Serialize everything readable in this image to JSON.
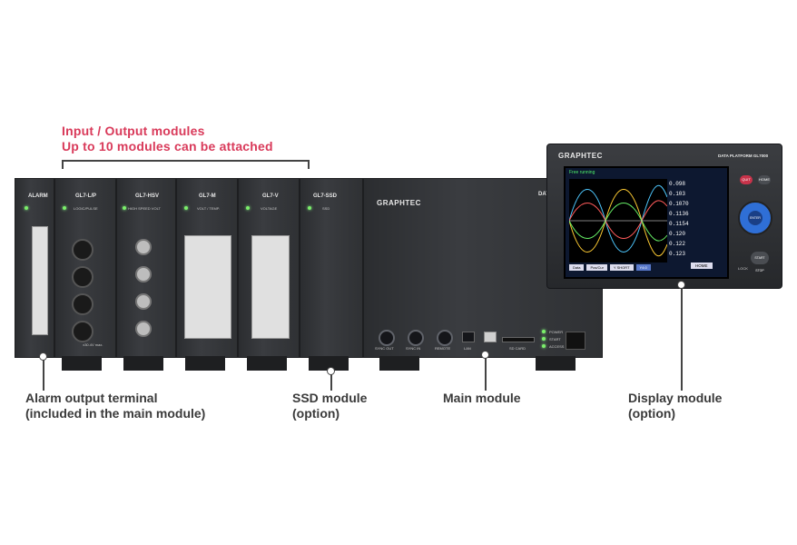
{
  "captions": {
    "io_line1": "Input / Output modules",
    "io_line2": "Up to 10 modules can be attached",
    "alarm_line1": "Alarm output terminal",
    "alarm_line2": "(included in the main module)",
    "ssd_line1": "SSD module",
    "ssd_line2": "(option)",
    "main_line1": "Main module",
    "display_line1": "Display module",
    "display_line2": "(option)"
  },
  "modules": {
    "alarm": "ALARM",
    "lp": "GL7-L/P",
    "lp_sub": "LOGIC/PULSE",
    "lp_note": "±30.4V max.",
    "hsv": "GL7-HSV",
    "hsv_sub": "HIGH SPEED VOLT",
    "m": "GL7-M",
    "m_sub": "VOLT / TEMP.",
    "v": "GL7-V",
    "v_sub": "VOLTAGE",
    "ssd": "GL7-SSD",
    "ssd_sub": "SSD",
    "brand": "GRAPHTEC",
    "main_edge": "DATA",
    "port_sync_out": "SYNC OUT",
    "port_sync_in": "SYNC IN",
    "port_remote": "REMOTE",
    "port_lan": "LAN",
    "port_sd": "SD CARD",
    "status_power": "POWER",
    "status_start": "START",
    "status_access": "ACCESS"
  },
  "display": {
    "brand": "GRAPHTEC",
    "model": "DATA PLATFORM GL7000",
    "mode": "Free running",
    "btn_quit": "QUIT",
    "btn_home": "HOME",
    "btn_enter": "ENTER",
    "btn_start": "START STOP",
    "btn_lock": "LOCK",
    "tab1": "Data",
    "tab2": "Pos/Cur",
    "tab3": "Y SHORT",
    "tab4": "Y4:0",
    "home_btn": "HOME",
    "readings": [
      "0.098",
      "0.103",
      "0.1070",
      "0.1136",
      "0.1154",
      "0.120",
      "0.122",
      "0.123"
    ]
  },
  "colors": {
    "caption_red": "#d93a5a",
    "caption_dark": "#3a3a3a",
    "module_body": "#2f3134",
    "screen_bg": "#0d1830"
  }
}
